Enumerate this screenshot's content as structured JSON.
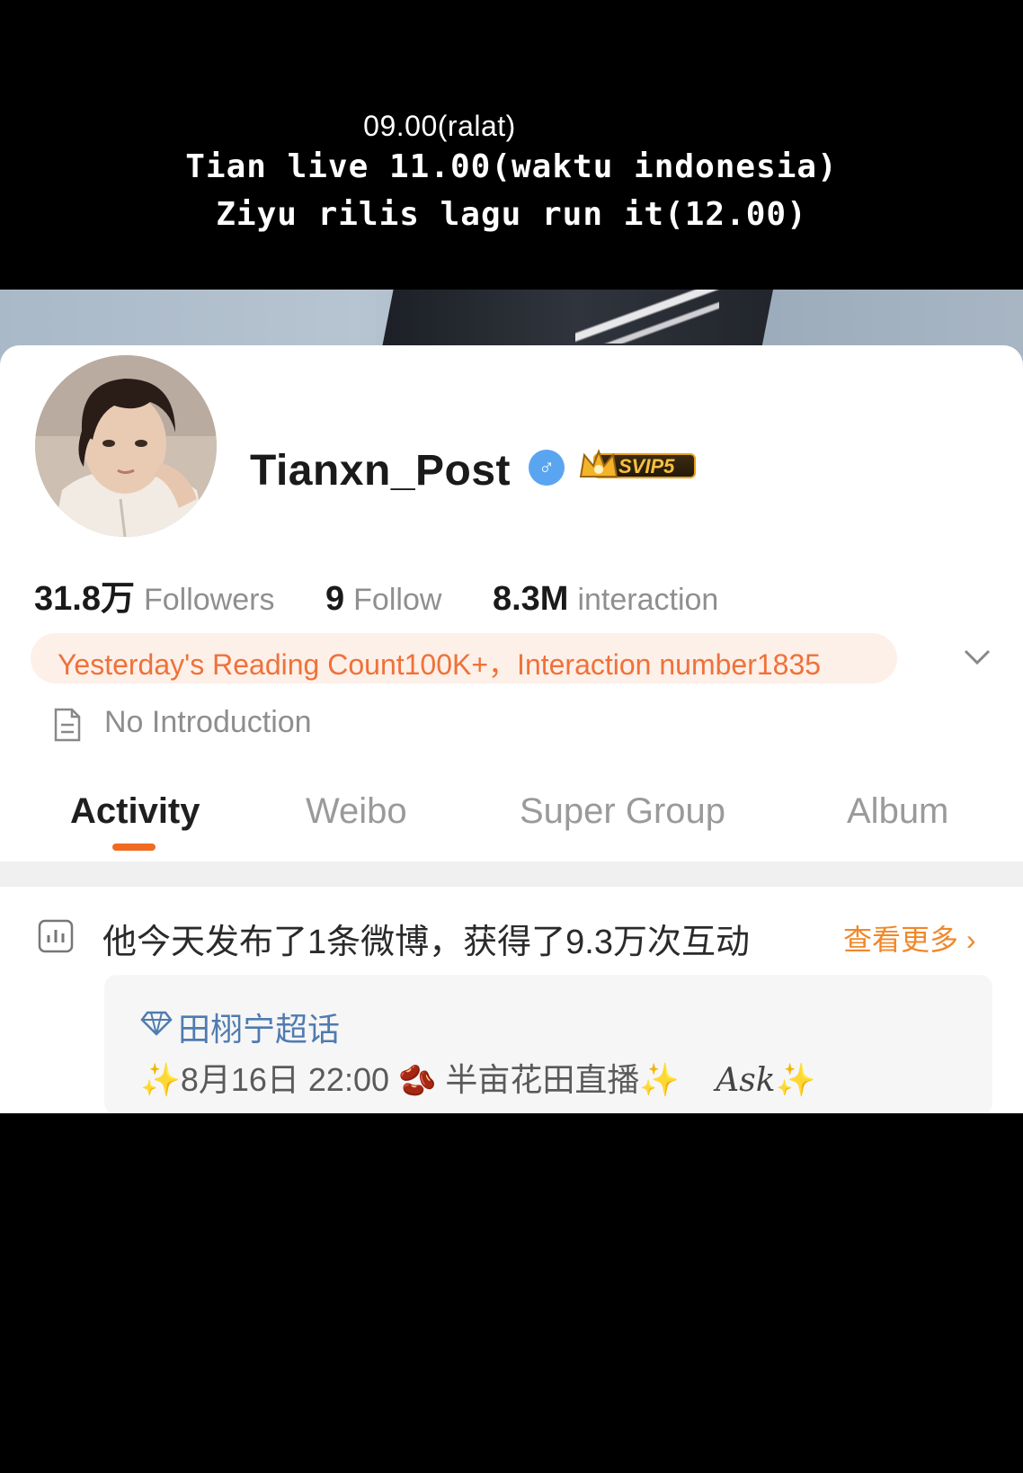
{
  "overlay": {
    "line1": "09.00(ralat)",
    "line2": "Tian live 11.00(waktu indonesia)",
    "line3": "Ziyu rilis lagu run it(12.00)"
  },
  "profile": {
    "username": "Tianxn_Post",
    "vip_badge": "SVIP5",
    "verified_icon": "male-verified-icon"
  },
  "stats": [
    {
      "value": "31.8万",
      "label": "Followers"
    },
    {
      "value": "9",
      "label": "Follow"
    },
    {
      "value": "8.3M",
      "label": "interaction"
    }
  ],
  "reading_banner": "Yesterday's Reading Count100K+，Interaction number1835",
  "intro": "No Introduction",
  "tabs": [
    {
      "label": "Activity",
      "active": true
    },
    {
      "label": "Weibo",
      "active": false
    },
    {
      "label": "Super Group",
      "active": false
    },
    {
      "label": "Album",
      "active": false
    }
  ],
  "activity": {
    "summary": "他今天发布了1条微博，获得了9.3万次互动",
    "more_link": "查看更多"
  },
  "post": {
    "group": "田栩宁超话",
    "spark_left": "✨",
    "datetime": "8月16日 22:00",
    "bean": "🫘",
    "title": "半亩花田直播",
    "spark_right": "✨",
    "ask": "Ask",
    "spark_end": "✨"
  },
  "colors": {
    "accent_orange": "#f06b22",
    "reading_text": "#f0713a",
    "link_orange": "#f0882a",
    "verified_blue": "#5aa5f0",
    "group_blue": "#4f7bb0"
  }
}
